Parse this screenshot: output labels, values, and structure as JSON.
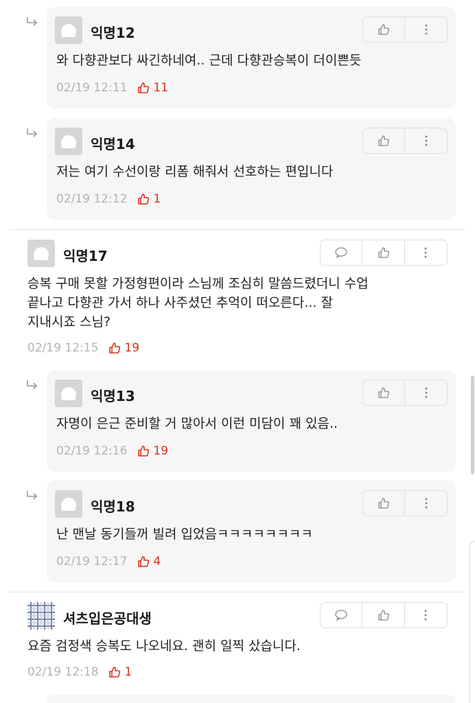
{
  "replies_top": [
    {
      "nickname": "익명12",
      "text": "와 다향관보다 싸긴하네여.. 근데 다향관승복이 더이쁜듯",
      "time": "02/19 12:11",
      "likes": "11"
    },
    {
      "nickname": "익명14",
      "text": "저는 여기 수선이랑 리폼 해줘서 선호하는 편입니다",
      "time": "02/19 12:12",
      "likes": "1"
    }
  ],
  "comment_17": {
    "nickname": "익명17",
    "text": "승복 구매 못할 가정형편이라 스님께 조심히 말씀드렸더니 수업\n끝나고 다향관 가서 하나 사주셨던 추억이 떠오른다... 잘\n지내시죠 스님?",
    "time": "02/19 12:15",
    "likes": "19"
  },
  "replies_mid": [
    {
      "nickname": "익명13",
      "text": "자명이 은근 준비할 거 많아서 이런 미담이 꽤 있음..",
      "time": "02/19 12:16",
      "likes": "19"
    },
    {
      "nickname": "익명18",
      "text": "난 맨날 동기들꺼 빌려 입었음ㅋㅋㅋㅋㅋㅋㅋㅋ",
      "time": "02/19 12:17",
      "likes": "4"
    }
  ],
  "comment_bottom": {
    "nickname": "셔츠입은공대생",
    "text": "요즘 검정색 승복도 나오네요. 괜히 일찍 샀습니다.",
    "time": "02/19 12:18",
    "likes": "1"
  },
  "icons": {
    "reply_arrow": "reply-arrow-icon",
    "comment": "speech-bubble-icon",
    "like": "thumbs-up-icon",
    "more": "more-vertical-icon",
    "avatar_default": "default-avatar-icon",
    "avatar_plaid": "plaid-avatar-icon"
  },
  "colors": {
    "like_red": "#d6311b",
    "meta_gray": "#b3b3b3",
    "card_bg": "#f6f6f6"
  }
}
